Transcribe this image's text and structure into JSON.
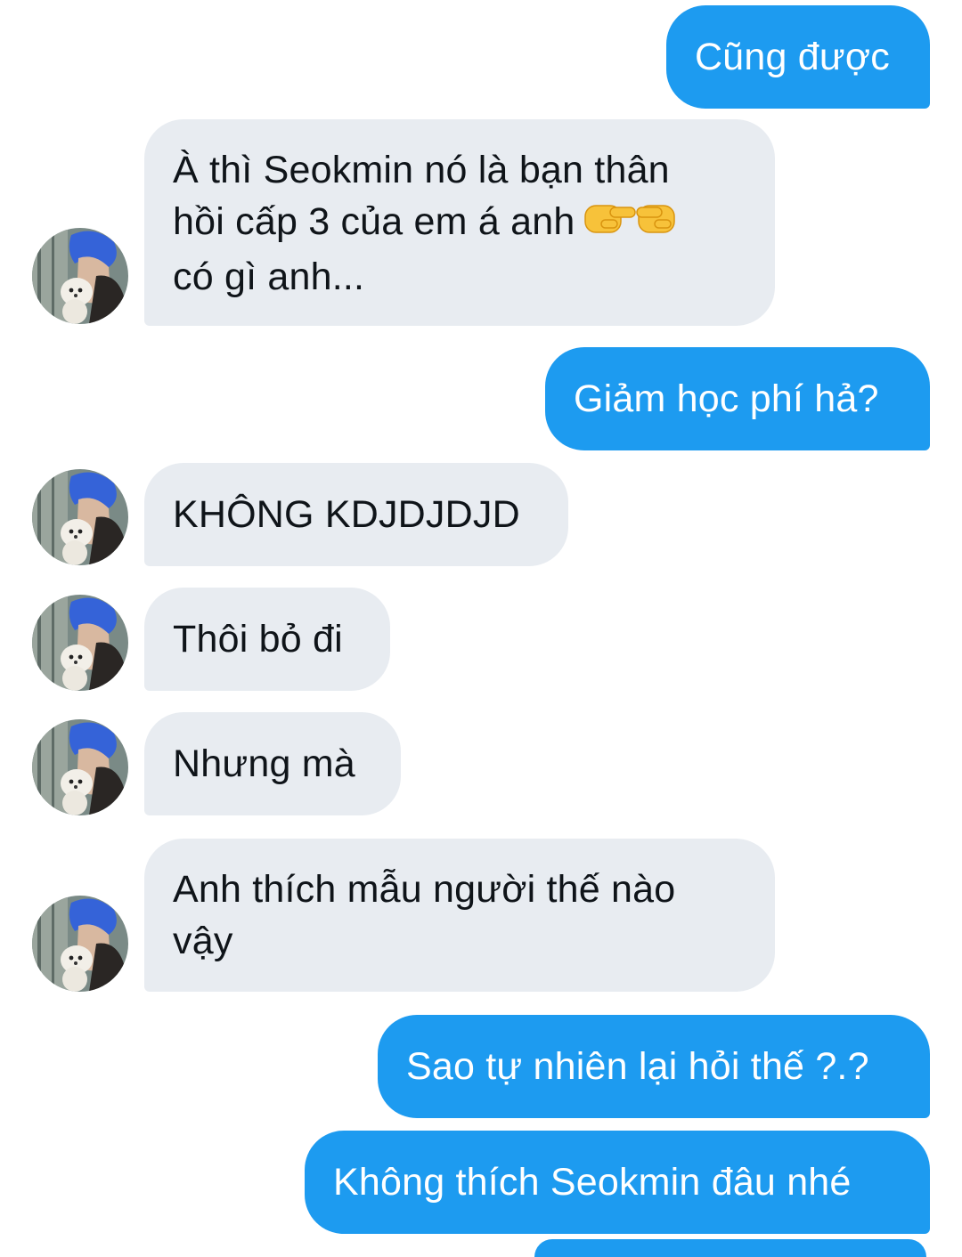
{
  "colors": {
    "sent_bubble": "#1d9bf0",
    "received_bubble": "#e8ecf1",
    "sent_text": "#ffffff",
    "received_text": "#0f1419"
  },
  "avatar_icon": "profile-photo-blue-hair-with-white-puppy",
  "messages": [
    {
      "id": "m1",
      "direction": "sent",
      "text": "Cũng được"
    },
    {
      "id": "m2",
      "direction": "received",
      "lines": [
        "À thì Seokmin nó là bạn thân",
        "hồi cấp 3 của em á anh",
        "có gì anh..."
      ],
      "emoji": "pointing-right-left-hands-emoji"
    },
    {
      "id": "m3",
      "direction": "sent",
      "text": "Giảm học phí hả?"
    },
    {
      "id": "m4",
      "direction": "received",
      "text": "KHÔNG KDJDJDJD"
    },
    {
      "id": "m5",
      "direction": "received",
      "text": "Thôi bỏ đi"
    },
    {
      "id": "m6",
      "direction": "received",
      "text": "Nhưng mà"
    },
    {
      "id": "m7",
      "direction": "received",
      "lines": [
        "Anh thích mẫu người thế nào",
        "vậy"
      ]
    },
    {
      "id": "m8",
      "direction": "sent",
      "text": "Sao tự nhiên lại hỏi thế ?.?"
    },
    {
      "id": "m9",
      "direction": "sent",
      "text": "Không thích Seokmin đâu nhé"
    }
  ]
}
